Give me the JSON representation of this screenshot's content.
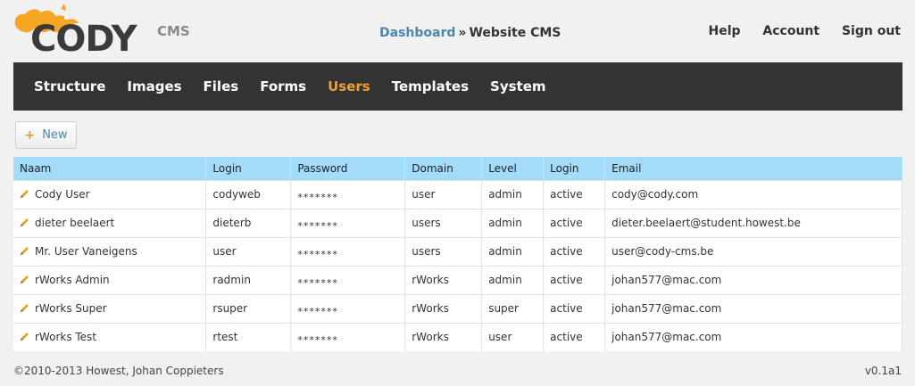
{
  "brand": {
    "name": "CODY",
    "suffix": "CMS"
  },
  "breadcrumb": {
    "link": "Dashboard",
    "separator": "»",
    "current": "Website CMS"
  },
  "toplinks": [
    "Help",
    "Account",
    "Sign out"
  ],
  "nav": {
    "items": [
      "Structure",
      "Images",
      "Files",
      "Forms",
      "Users",
      "Templates",
      "System"
    ],
    "active": "Users"
  },
  "toolbar": {
    "new_label": "New"
  },
  "table": {
    "columns": [
      "Naam",
      "Login",
      "Password",
      "Domain",
      "Level",
      "Login",
      "Email"
    ],
    "rows": [
      [
        "Cody User",
        "codyweb",
        "*******",
        "user",
        "admin",
        "active",
        "cody@cody.com"
      ],
      [
        "dieter beelaert",
        "dieterb",
        "*******",
        "users",
        "admin",
        "active",
        "dieter.beelaert@student.howest.be"
      ],
      [
        "Mr. User Vaneigens",
        "user",
        "*******",
        "users",
        "admin",
        "active",
        "user@cody-cms.be"
      ],
      [
        "rWorks Admin",
        "radmin",
        "*******",
        "rWorks",
        "admin",
        "active",
        "johan577@mac.com"
      ],
      [
        "rWorks Super",
        "rsuper",
        "*******",
        "rWorks",
        "super",
        "active",
        "johan577@mac.com"
      ],
      [
        "rWorks Test",
        "rtest",
        "*******",
        "rWorks",
        "user",
        "active",
        "johan577@mac.com"
      ]
    ]
  },
  "footer": {
    "copyright": "©2010-2013 Howest, Johan Coppieters",
    "version": "v0.1a1"
  },
  "colors": {
    "accent": "#f0a030",
    "link": "#4a86b0",
    "nav_bg": "#333333",
    "table_header": "#a2dcf9"
  }
}
